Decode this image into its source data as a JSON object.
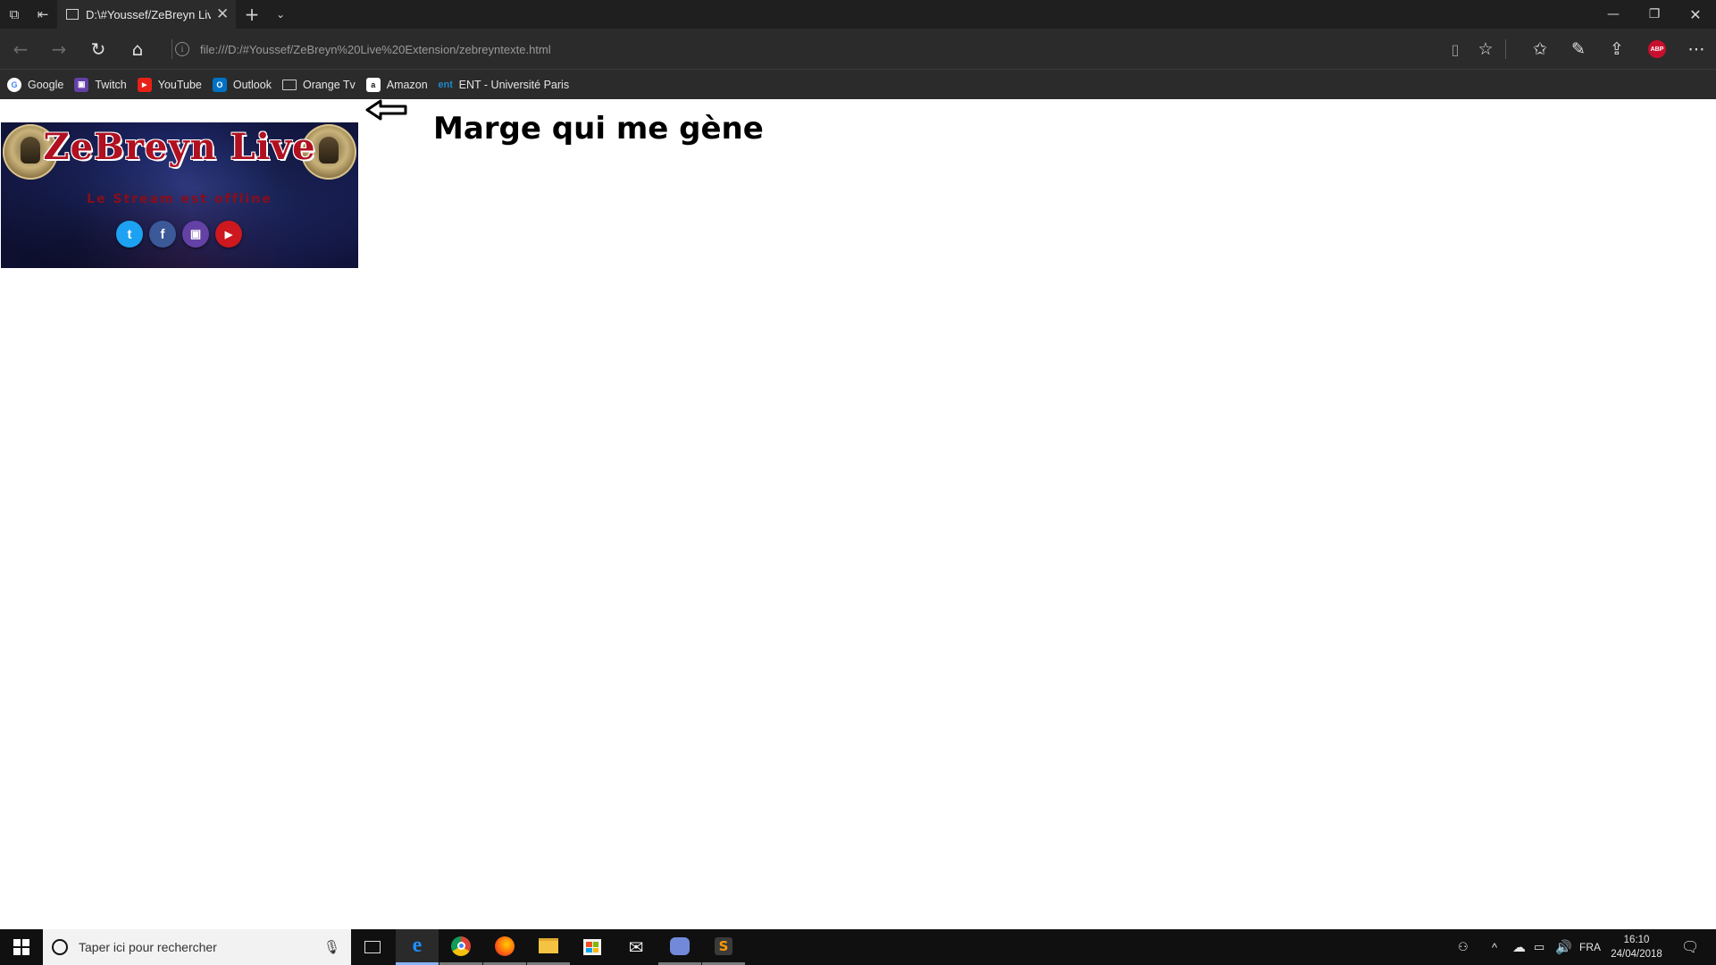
{
  "browser": {
    "tab": {
      "title": "D:\\#Youssef/ZeBreyn Live Extension/zebreyntexte.html"
    },
    "address": {
      "url": "file:///D:/#Youssef/ZeBreyn%20Live%20Extension/zebreyntexte.html"
    },
    "abp_label": "ABP",
    "favorites": [
      {
        "label": "Google",
        "icon": "google-icon",
        "color": "#ffffff"
      },
      {
        "label": "Twitch",
        "icon": "twitch-icon",
        "color": "#6441a5"
      },
      {
        "label": "YouTube",
        "icon": "youtube-icon",
        "color": "#e62117"
      },
      {
        "label": "Outlook",
        "icon": "outlook-icon",
        "color": "#0072c6"
      },
      {
        "label": "Orange Tv",
        "icon": "tv-icon",
        "color": "#2b2b2b"
      },
      {
        "label": "Amazon",
        "icon": "amazon-icon",
        "color": "#ffffff"
      },
      {
        "label": "ENT - Université Paris",
        "icon": "ent-icon",
        "color": "#1e88c8"
      }
    ]
  },
  "page": {
    "banner": {
      "title": "ZeBreyn Live",
      "subtitle": "Le Stream est offline",
      "socials": [
        {
          "name": "twitter-icon",
          "glyph": "t",
          "color": "#1da1f2"
        },
        {
          "name": "facebook-icon",
          "glyph": "f",
          "color": "#3b5998"
        },
        {
          "name": "twitch-icon",
          "glyph": "▣",
          "color": "#6441a5"
        },
        {
          "name": "youtube-icon",
          "glyph": "▶",
          "color": "#cc181e"
        }
      ]
    },
    "heading": "Marge qui me gène"
  },
  "taskbar": {
    "search_placeholder": "Taper ici pour rechercher",
    "language": "FRA",
    "time": "16:10",
    "date": "24/04/2018"
  }
}
